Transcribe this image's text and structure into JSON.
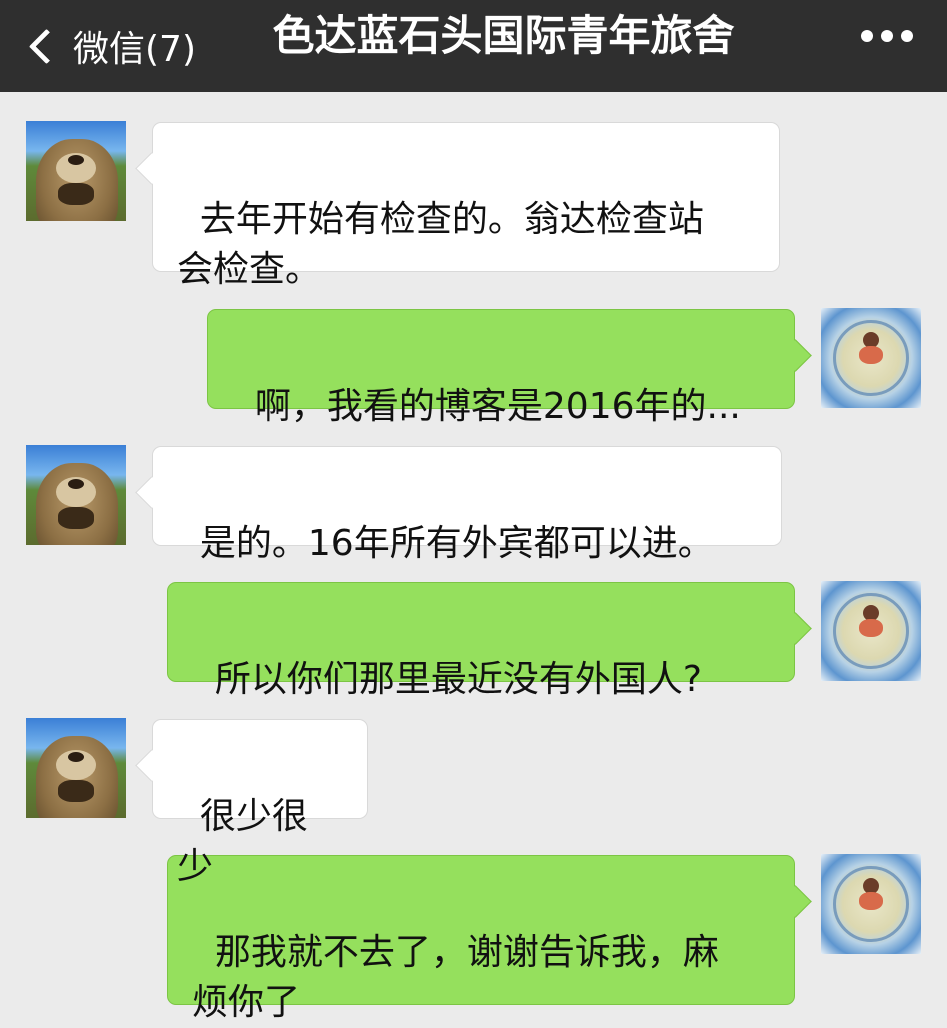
{
  "nav": {
    "back_label": "微信(7)",
    "title": "色达蓝石头国际青年旅舍"
  },
  "messages": [
    {
      "side": "left",
      "text": "去年开始有检查的。翁达检查站\n会检查。"
    },
    {
      "side": "right",
      "text": "啊，我看的博客是2016年的..."
    },
    {
      "side": "left",
      "text": "是的。16年所有外宾都可以进。"
    },
    {
      "side": "right",
      "text": "所以你们那里最近没有外国人?"
    },
    {
      "side": "left",
      "text": "很少很少"
    },
    {
      "side": "right",
      "text": "那我就不去了，谢谢告诉我，麻\n烦你了"
    }
  ],
  "colors": {
    "nav_bg": "#2f2f2f",
    "chat_bg": "#ebebeb",
    "own_bubble": "#95e05d",
    "other_bubble": "#ffffff"
  }
}
